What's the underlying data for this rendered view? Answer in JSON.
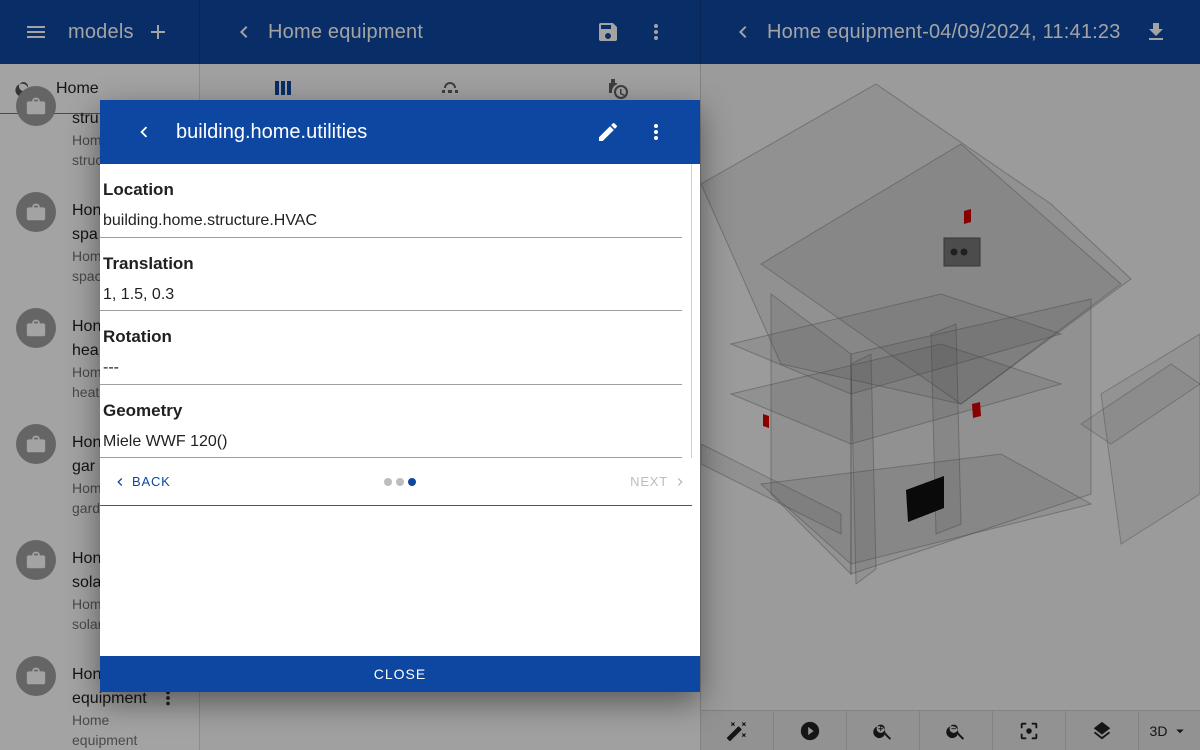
{
  "panel_left": {
    "title": "models",
    "search_value": "Home",
    "items": [
      {
        "title": "stru",
        "subtitle": "Hom",
        "subtitle2": "struc"
      },
      {
        "title": "Hon",
        "title2": "spa",
        "subtitle": "Hom",
        "subtitle2": "spac"
      },
      {
        "title": "Hon",
        "title2": "hea",
        "subtitle": "Hom",
        "subtitle2": "heat"
      },
      {
        "title": "Hon",
        "title2": "gar",
        "subtitle": "Hom",
        "subtitle2": "gard"
      },
      {
        "title": "Hon",
        "title2": "sola",
        "subtitle": "Hom",
        "subtitle2": "solar"
      },
      {
        "title": "Hon",
        "title2": "equipment",
        "subtitle": "Home",
        "subtitle2": "equipment"
      }
    ]
  },
  "panel_middle": {
    "title": "Home equipment"
  },
  "panel_right": {
    "title": "Home equipment-04/09/2024, 11:41:23",
    "view_mode": "3D"
  },
  "dialog": {
    "title": "building.home.utilities",
    "fields": [
      {
        "label": "Location",
        "value": "building.home.structure.HVAC"
      },
      {
        "label": "Translation",
        "value": "1, 1.5, 0.3"
      },
      {
        "label": "Rotation",
        "value": "---"
      },
      {
        "label": "Geometry",
        "value": "Miele WWF 120()"
      }
    ],
    "back_label": "BACK",
    "next_label": "NEXT",
    "close_label": "CLOSE",
    "step_active": 3,
    "step_total": 3
  },
  "colors": {
    "primary": "#0d47a1",
    "scrim": "rgba(0,0,0,0.36)"
  }
}
